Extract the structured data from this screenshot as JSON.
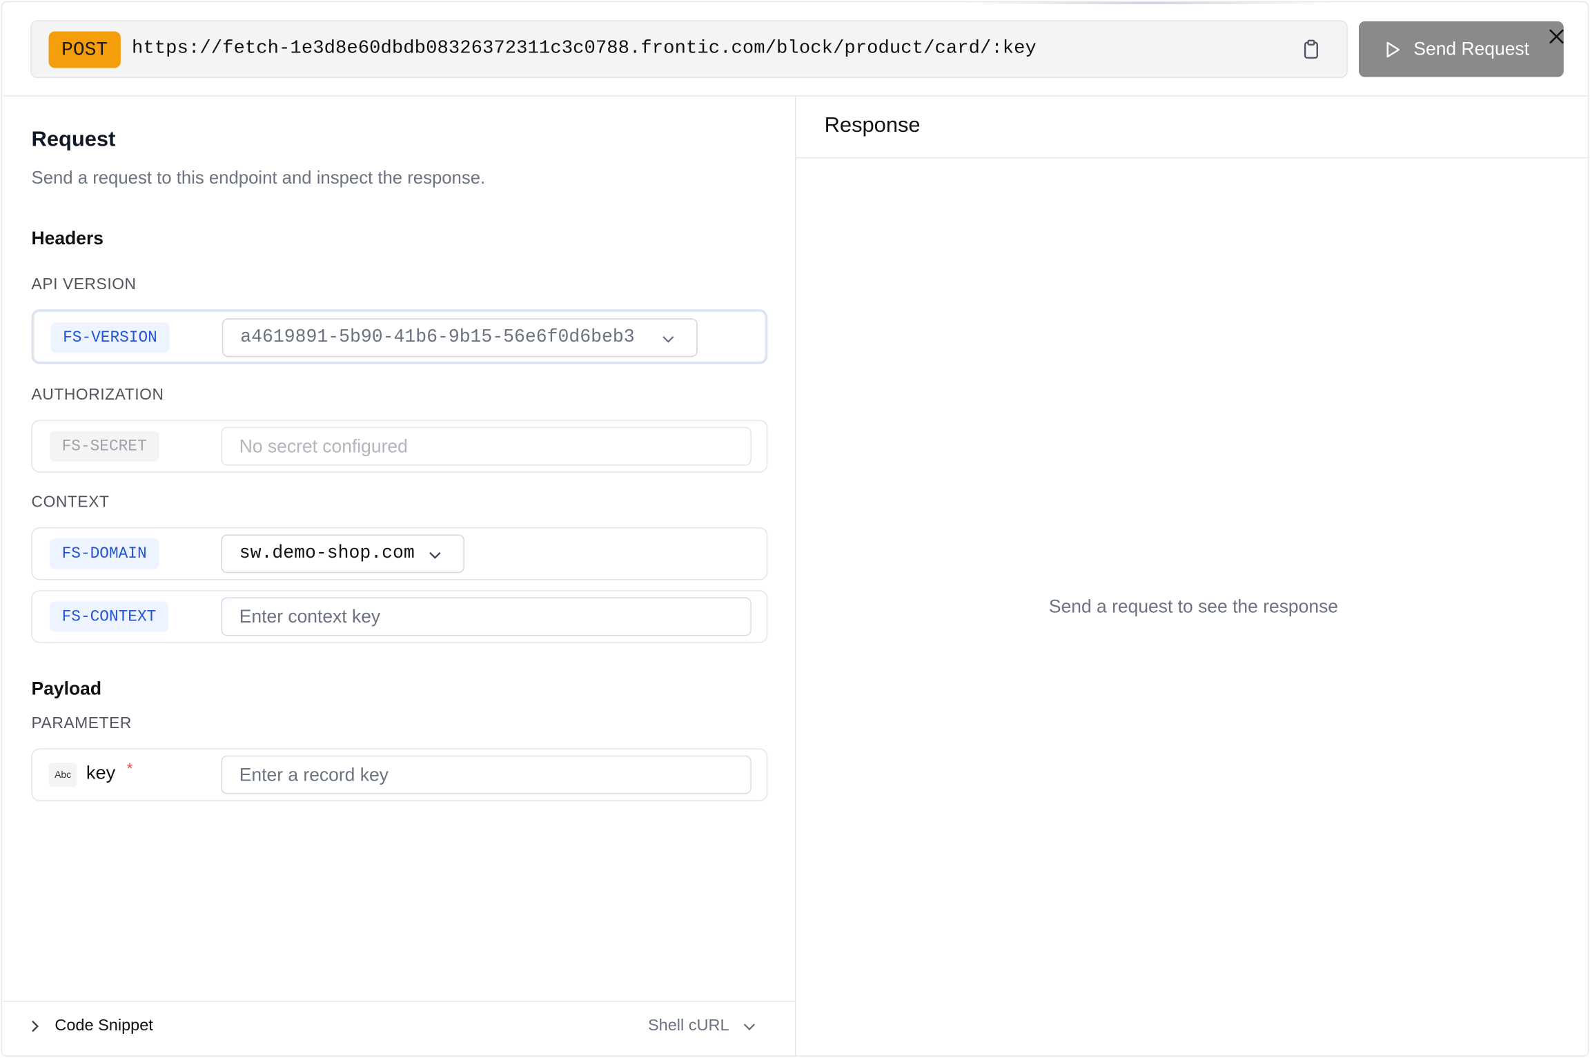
{
  "request_bar": {
    "method": "POST",
    "url": "https://fetch-1e3d8e60dbdb08326372311c3c0788.frontic.com/block/product/card/:key",
    "copy_icon": "clipboard-icon",
    "send_label": "Send Request",
    "send_icon": "play-icon",
    "close_icon": "close-icon"
  },
  "request": {
    "title": "Request",
    "subtitle": "Send a request to this endpoint and inspect the response.",
    "headers_title": "Headers",
    "api_version": {
      "label": "API VERSION",
      "header": "FS-VERSION",
      "value": "a4619891-5b90-41b6-9b15-56e6f0d6beb3"
    },
    "authorization": {
      "label": "AUTHORIZATION",
      "header": "FS-SECRET",
      "placeholder": "No secret configured"
    },
    "context": {
      "label": "CONTEXT",
      "domain_header": "FS-DOMAIN",
      "domain_value": "sw.demo-shop.com",
      "context_header": "FS-CONTEXT",
      "context_placeholder": "Enter context key"
    },
    "payload_title": "Payload",
    "parameter": {
      "label": "PARAMETER",
      "type_badge": "Abc",
      "name": "key",
      "required_mark": "*",
      "placeholder": "Enter a record key"
    }
  },
  "footer": {
    "code_snippet_label": "Code Snippet",
    "language": "Shell cURL"
  },
  "response": {
    "title": "Response",
    "empty_text": "Send a request to see the response"
  },
  "colors": {
    "method_badge": "#f59e0b",
    "send_button": "#8a8a8a",
    "header_tag_text": "#2454d6",
    "required": "#ef4444"
  }
}
